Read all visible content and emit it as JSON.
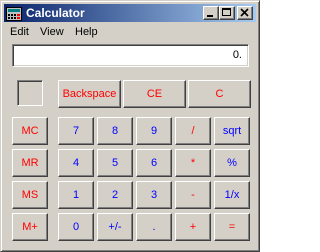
{
  "window": {
    "title": "Calculator",
    "colors": {
      "titlebar_start": "#0a246a",
      "titlebar_end": "#a6caf0",
      "face": "#d4d0c8",
      "digit_text": "#0000ff",
      "op_text": "#ff0000"
    },
    "caption_icons": [
      "minimize-icon",
      "maximize-icon",
      "close-icon"
    ]
  },
  "menu": {
    "edit": "Edit",
    "view": "View",
    "help": "Help"
  },
  "display": {
    "value": "0."
  },
  "memory": {
    "indicator": ""
  },
  "buttons": {
    "backspace": "Backspace",
    "ce": "CE",
    "c": "C",
    "mc": "MC",
    "mr": "MR",
    "ms": "MS",
    "mplus": "M+",
    "seven": "7",
    "eight": "8",
    "nine": "9",
    "divide": "/",
    "sqrt": "sqrt",
    "four": "4",
    "five": "5",
    "six": "6",
    "multiply": "*",
    "percent": "%",
    "one": "1",
    "two": "2",
    "three": "3",
    "minus": "-",
    "reciprocal": "1/x",
    "zero": "0",
    "sign": "+/-",
    "decimal": ".",
    "plus": "+",
    "equals": "="
  }
}
